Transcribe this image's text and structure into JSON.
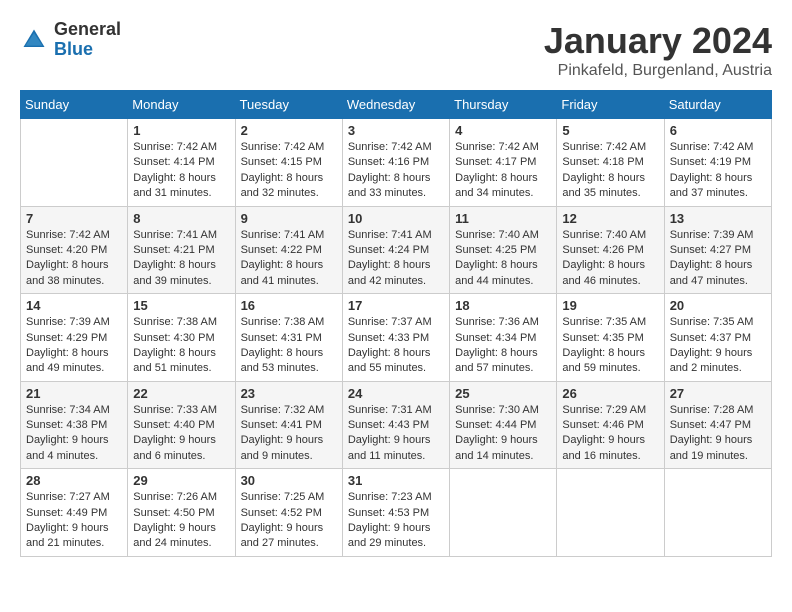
{
  "logo": {
    "line1": "General",
    "line2": "Blue"
  },
  "title": "January 2024",
  "location": "Pinkafeld, Burgenland, Austria",
  "days_of_week": [
    "Sunday",
    "Monday",
    "Tuesday",
    "Wednesday",
    "Thursday",
    "Friday",
    "Saturday"
  ],
  "weeks": [
    [
      {
        "day": "",
        "info": ""
      },
      {
        "day": "1",
        "info": "Sunrise: 7:42 AM\nSunset: 4:14 PM\nDaylight: 8 hours\nand 31 minutes."
      },
      {
        "day": "2",
        "info": "Sunrise: 7:42 AM\nSunset: 4:15 PM\nDaylight: 8 hours\nand 32 minutes."
      },
      {
        "day": "3",
        "info": "Sunrise: 7:42 AM\nSunset: 4:16 PM\nDaylight: 8 hours\nand 33 minutes."
      },
      {
        "day": "4",
        "info": "Sunrise: 7:42 AM\nSunset: 4:17 PM\nDaylight: 8 hours\nand 34 minutes."
      },
      {
        "day": "5",
        "info": "Sunrise: 7:42 AM\nSunset: 4:18 PM\nDaylight: 8 hours\nand 35 minutes."
      },
      {
        "day": "6",
        "info": "Sunrise: 7:42 AM\nSunset: 4:19 PM\nDaylight: 8 hours\nand 37 minutes."
      }
    ],
    [
      {
        "day": "7",
        "info": "Sunrise: 7:42 AM\nSunset: 4:20 PM\nDaylight: 8 hours\nand 38 minutes."
      },
      {
        "day": "8",
        "info": "Sunrise: 7:41 AM\nSunset: 4:21 PM\nDaylight: 8 hours\nand 39 minutes."
      },
      {
        "day": "9",
        "info": "Sunrise: 7:41 AM\nSunset: 4:22 PM\nDaylight: 8 hours\nand 41 minutes."
      },
      {
        "day": "10",
        "info": "Sunrise: 7:41 AM\nSunset: 4:24 PM\nDaylight: 8 hours\nand 42 minutes."
      },
      {
        "day": "11",
        "info": "Sunrise: 7:40 AM\nSunset: 4:25 PM\nDaylight: 8 hours\nand 44 minutes."
      },
      {
        "day": "12",
        "info": "Sunrise: 7:40 AM\nSunset: 4:26 PM\nDaylight: 8 hours\nand 46 minutes."
      },
      {
        "day": "13",
        "info": "Sunrise: 7:39 AM\nSunset: 4:27 PM\nDaylight: 8 hours\nand 47 minutes."
      }
    ],
    [
      {
        "day": "14",
        "info": "Sunrise: 7:39 AM\nSunset: 4:29 PM\nDaylight: 8 hours\nand 49 minutes."
      },
      {
        "day": "15",
        "info": "Sunrise: 7:38 AM\nSunset: 4:30 PM\nDaylight: 8 hours\nand 51 minutes."
      },
      {
        "day": "16",
        "info": "Sunrise: 7:38 AM\nSunset: 4:31 PM\nDaylight: 8 hours\nand 53 minutes."
      },
      {
        "day": "17",
        "info": "Sunrise: 7:37 AM\nSunset: 4:33 PM\nDaylight: 8 hours\nand 55 minutes."
      },
      {
        "day": "18",
        "info": "Sunrise: 7:36 AM\nSunset: 4:34 PM\nDaylight: 8 hours\nand 57 minutes."
      },
      {
        "day": "19",
        "info": "Sunrise: 7:35 AM\nSunset: 4:35 PM\nDaylight: 8 hours\nand 59 minutes."
      },
      {
        "day": "20",
        "info": "Sunrise: 7:35 AM\nSunset: 4:37 PM\nDaylight: 9 hours\nand 2 minutes."
      }
    ],
    [
      {
        "day": "21",
        "info": "Sunrise: 7:34 AM\nSunset: 4:38 PM\nDaylight: 9 hours\nand 4 minutes."
      },
      {
        "day": "22",
        "info": "Sunrise: 7:33 AM\nSunset: 4:40 PM\nDaylight: 9 hours\nand 6 minutes."
      },
      {
        "day": "23",
        "info": "Sunrise: 7:32 AM\nSunset: 4:41 PM\nDaylight: 9 hours\nand 9 minutes."
      },
      {
        "day": "24",
        "info": "Sunrise: 7:31 AM\nSunset: 4:43 PM\nDaylight: 9 hours\nand 11 minutes."
      },
      {
        "day": "25",
        "info": "Sunrise: 7:30 AM\nSunset: 4:44 PM\nDaylight: 9 hours\nand 14 minutes."
      },
      {
        "day": "26",
        "info": "Sunrise: 7:29 AM\nSunset: 4:46 PM\nDaylight: 9 hours\nand 16 minutes."
      },
      {
        "day": "27",
        "info": "Sunrise: 7:28 AM\nSunset: 4:47 PM\nDaylight: 9 hours\nand 19 minutes."
      }
    ],
    [
      {
        "day": "28",
        "info": "Sunrise: 7:27 AM\nSunset: 4:49 PM\nDaylight: 9 hours\nand 21 minutes."
      },
      {
        "day": "29",
        "info": "Sunrise: 7:26 AM\nSunset: 4:50 PM\nDaylight: 9 hours\nand 24 minutes."
      },
      {
        "day": "30",
        "info": "Sunrise: 7:25 AM\nSunset: 4:52 PM\nDaylight: 9 hours\nand 27 minutes."
      },
      {
        "day": "31",
        "info": "Sunrise: 7:23 AM\nSunset: 4:53 PM\nDaylight: 9 hours\nand 29 minutes."
      },
      {
        "day": "",
        "info": ""
      },
      {
        "day": "",
        "info": ""
      },
      {
        "day": "",
        "info": ""
      }
    ]
  ]
}
